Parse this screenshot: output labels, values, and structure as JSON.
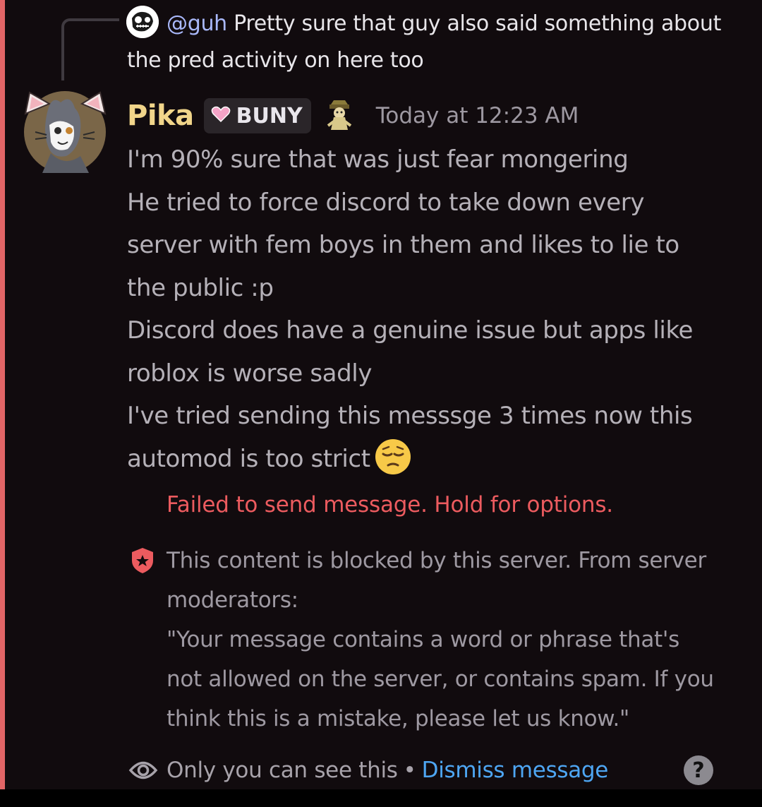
{
  "reply": {
    "mention": "@guh",
    "text": " Pretty sure that guy also said something about the pred activity on here too"
  },
  "message": {
    "username": "Pika",
    "tag": "BUNY",
    "timestamp": "Today at 12:23 AM",
    "lines": [
      "I'm 90% sure that was just fear mongering",
      "He tried to force discord to take down every",
      "server with fem boys in them and likes to lie to",
      "the public :p",
      "Discord does have a genuine issue but apps like",
      "roblox is worse sadly",
      "I've tried sending this messsge 3 times now this",
      "automod is too strict"
    ],
    "emoji": "pensive-face"
  },
  "failed_text": "Failed to send message. Hold for options.",
  "blocked": {
    "lines": [
      "This content is blocked by this server. From server",
      "moderators:",
      "\"Your message contains a word or phrase that's",
      "not allowed on the server, or contains spam. If you",
      "think this is a mistake, please let us know.\""
    ]
  },
  "footer": {
    "visibility": "Only you can see this",
    "separator": "•",
    "dismiss": "Dismiss message",
    "help": "?"
  },
  "colors": {
    "accent_bar": "#e26566",
    "username": "#f1d58a",
    "error": "#ec5b5f",
    "link": "#4ea6f3",
    "mention": "#a9b8fa"
  }
}
